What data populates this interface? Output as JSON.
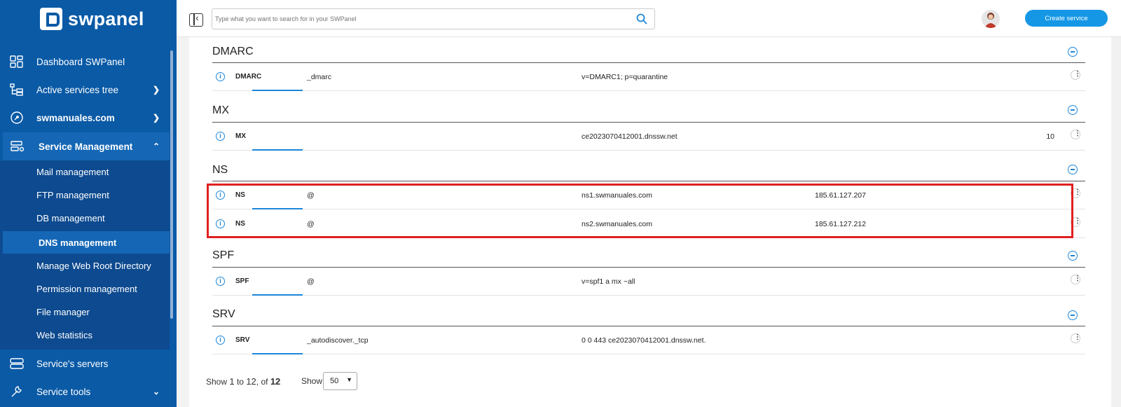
{
  "brand": {
    "name": "swpanel"
  },
  "colors": {
    "sidebar": "#0a5aa6",
    "accent": "#1e86d8",
    "highlight": "#e02020",
    "button": "#1597e5"
  },
  "sidebar": {
    "items": [
      {
        "label": "Dashboard SWPanel",
        "icon": "dashboard-icon"
      },
      {
        "label": "Active services tree",
        "icon": "tree-icon"
      },
      {
        "label": "swmanuales.com",
        "icon": "domain-icon"
      },
      {
        "label": "Service Management",
        "icon": "service-management-icon"
      },
      {
        "label": "Service's servers",
        "icon": "servers-icon"
      },
      {
        "label": "Service tools",
        "icon": "tools-icon"
      }
    ],
    "sub_items": [
      {
        "label": "Mail management"
      },
      {
        "label": "FTP management"
      },
      {
        "label": "DB management"
      },
      {
        "label": "DNS management"
      },
      {
        "label": "Manage Web Root Directory"
      },
      {
        "label": "Permission management"
      },
      {
        "label": "File manager"
      },
      {
        "label": "Web statistics"
      }
    ]
  },
  "topbar": {
    "search_placeholder": "Type what you want to search for in your SWPanel",
    "create_label": "Create service"
  },
  "sections": [
    {
      "title": "DMARC",
      "rows": [
        {
          "type": "DMARC",
          "name": "_dmarc",
          "value": "v=DMARC1; p=quarantine",
          "extra": "",
          "priority": ""
        }
      ]
    },
    {
      "title": "MX",
      "rows": [
        {
          "type": "MX",
          "name": "",
          "value": "ce2023070412001.dnssw.net",
          "extra": "",
          "priority": "10"
        }
      ]
    },
    {
      "title": "NS",
      "rows": [
        {
          "type": "NS",
          "name": "@",
          "value": "ns1.swmanuales.com",
          "extra": "185.61.127.207",
          "priority": ""
        },
        {
          "type": "NS",
          "name": "@",
          "value": "ns2.swmanuales.com",
          "extra": "185.61.127.212",
          "priority": ""
        }
      ]
    },
    {
      "title": "SPF",
      "rows": [
        {
          "type": "SPF",
          "name": "@",
          "value": "v=spf1 a mx ~all",
          "extra": "",
          "priority": ""
        }
      ]
    },
    {
      "title": "SRV",
      "rows": [
        {
          "type": "SRV",
          "name": "_autodiscover._tcp",
          "value": "0 0 443 ce2023070412001.dnssw.net.",
          "extra": "",
          "priority": ""
        }
      ]
    }
  ],
  "pagination": {
    "prefix": "Show",
    "from": "1",
    "to_word": "to",
    "to": "12",
    "of_word": ", of",
    "total": "12",
    "show_label": "Show",
    "show_value": "50"
  }
}
